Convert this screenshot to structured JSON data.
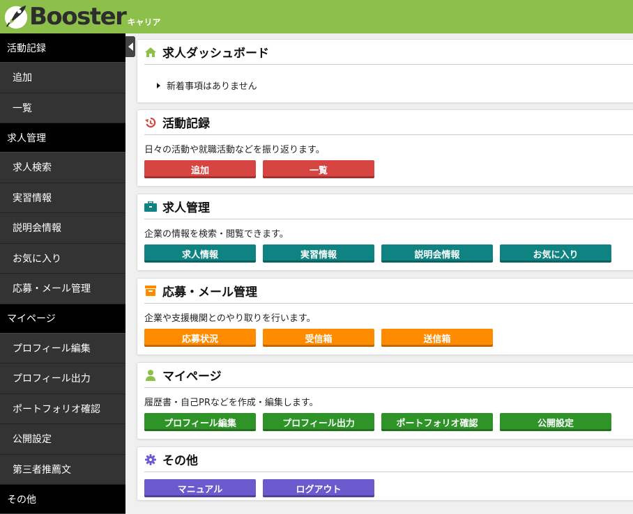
{
  "header": {
    "logo_text": "Booster",
    "logo_sub": "キャリア",
    "bg_color": "#8cc04a"
  },
  "sidebar": {
    "sections": [
      {
        "title": "活動記録",
        "items": [
          "追加",
          "一覧"
        ]
      },
      {
        "title": "求人管理",
        "items": [
          "求人検索",
          "実習情報",
          "説明会情報",
          "お気に入り",
          "応募・メール管理"
        ]
      },
      {
        "title": "マイページ",
        "items": [
          "プロフィール編集",
          "プロフィール出力",
          "ポートフォリオ確認",
          "公開設定",
          "第三者推薦文"
        ]
      },
      {
        "title": "その他",
        "items": []
      }
    ]
  },
  "dashboard": {
    "title": "求人ダッシュボード",
    "icon": "home-icon",
    "news": "新着事項はありません"
  },
  "activity": {
    "title": "活動記録",
    "icon": "history-icon",
    "desc": "日々の活動や就職活動などを振り返ります。",
    "buttons": [
      "追加",
      "一覧"
    ],
    "color": "#d64541"
  },
  "jobs": {
    "title": "求人管理",
    "icon": "briefcase-icon",
    "desc": "企業の情報を検索・閲覧できます。",
    "buttons": [
      "求人情報",
      "実習情報",
      "説明会情報",
      "お気に入り"
    ],
    "color": "#0e8381"
  },
  "mail": {
    "title": "応募・メール管理",
    "icon": "inbox-icon",
    "desc": "企業や支援機関とのやり取りを行います。",
    "buttons": [
      "応募状況",
      "受信箱",
      "送信箱"
    ],
    "color": "#ff8c00"
  },
  "mypage": {
    "title": "マイページ",
    "icon": "user-icon",
    "desc": "履歴書・自己PRなどを作成・編集します。",
    "buttons": [
      "プロフィール編集",
      "プロフィール出力",
      "ポートフォリオ確認",
      "公開設定"
    ],
    "color": "#2e9428"
  },
  "other": {
    "title": "その他",
    "icon": "gear-icon",
    "buttons": [
      "マニュアル",
      "ログアウト"
    ],
    "color": "#6a5acd"
  }
}
